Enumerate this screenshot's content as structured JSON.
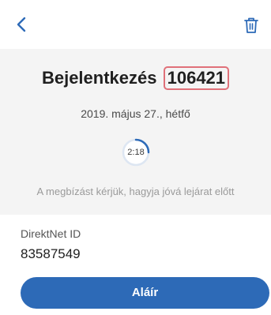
{
  "header": {
    "back_icon": "chevron-left-icon",
    "delete_icon": "trash-icon",
    "accent_color": "#2d6ab7"
  },
  "main": {
    "title_prefix": "Bejelentkezés",
    "title_code": "106421",
    "date": "2019. május 27., hétfő",
    "timer": {
      "label": "2:18",
      "progress": 0.25
    },
    "hint": "A megbízást kérjük, hagyja jóvá lejárat előtt"
  },
  "account": {
    "label": "DirektNet ID",
    "value": "83587549"
  },
  "actions": {
    "sign_label": "Aláír"
  }
}
